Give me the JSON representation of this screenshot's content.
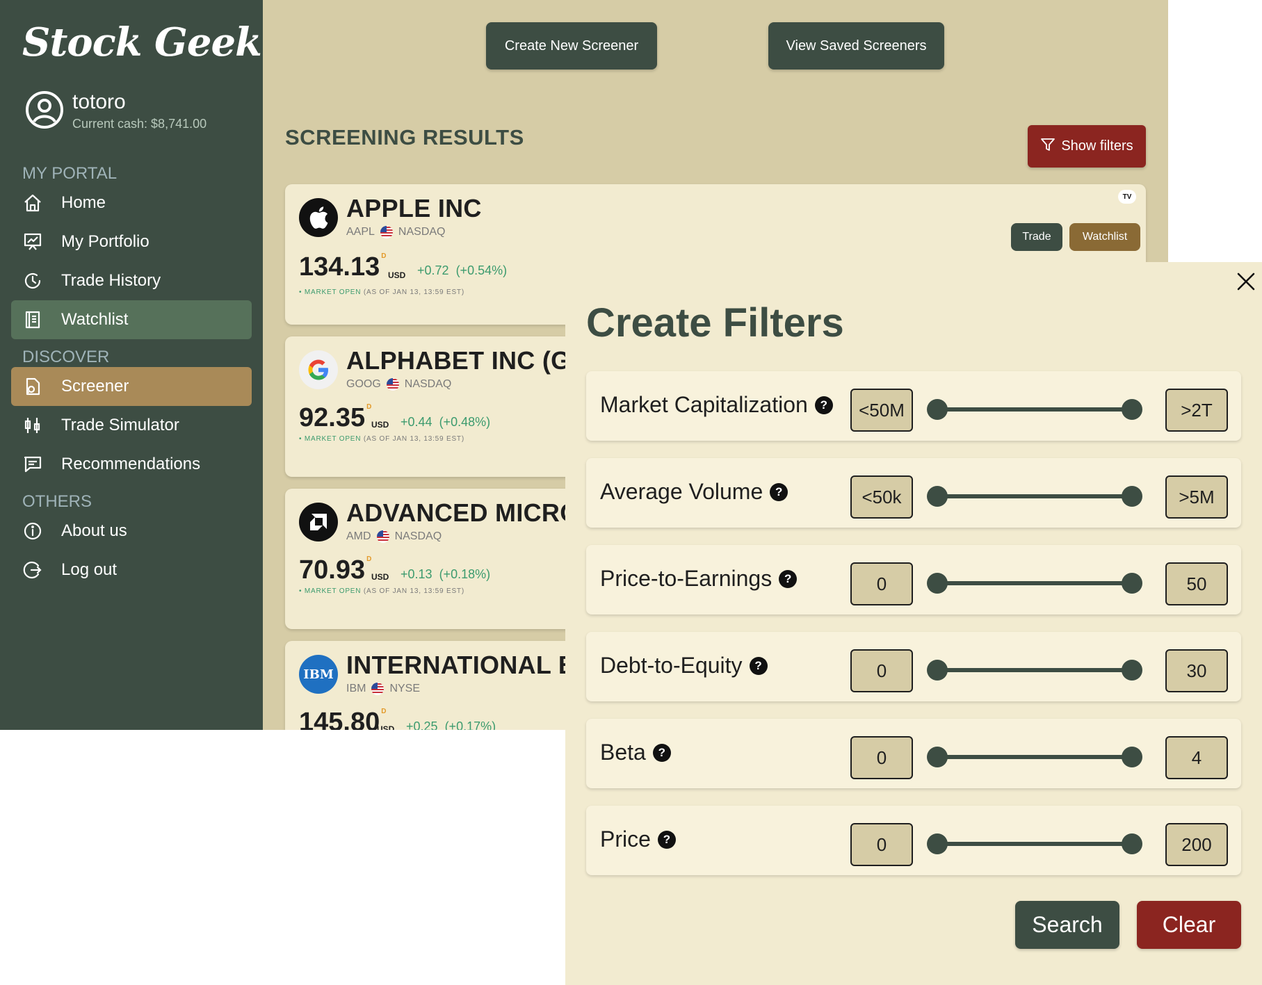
{
  "app": {
    "logo": "Stock Geek"
  },
  "user": {
    "name": "totoro",
    "cash": "Current cash: $8,741.00"
  },
  "sidebar": {
    "sections": [
      {
        "title": "MY PORTAL",
        "items": [
          {
            "label": "Home",
            "icon": "home-icon"
          },
          {
            "label": "My Portfolio",
            "icon": "portfolio-icon"
          },
          {
            "label": "Trade History",
            "icon": "history-icon"
          },
          {
            "label": "Watchlist",
            "icon": "watchlist-icon"
          }
        ]
      },
      {
        "title": "DISCOVER",
        "items": [
          {
            "label": "Screener",
            "icon": "screener-icon"
          },
          {
            "label": "Trade Simulator",
            "icon": "simulator-icon"
          },
          {
            "label": "Recommendations",
            "icon": "recommendations-icon"
          }
        ]
      },
      {
        "title": "OTHERS",
        "items": [
          {
            "label": "About us",
            "icon": "info-icon"
          },
          {
            "label": "Log out",
            "icon": "logout-icon"
          }
        ]
      }
    ]
  },
  "toolbar": {
    "create_label": "Create New Screener",
    "view_label": "View Saved Screeners"
  },
  "results": {
    "title": "SCREENING RESULTS",
    "show_filters_label": "Show filters"
  },
  "stocks": [
    {
      "name": "APPLE INC",
      "ticker": "AAPL",
      "exchange": "NASDAQ",
      "price": "134.13",
      "price_marker": "D",
      "currency": "USD",
      "change": "+0.72",
      "change_pct": "(+0.54%)",
      "status": "MARKET OPEN",
      "as_of": "(AS OF JAN 13, 13:59 EST)",
      "trade_label": "Trade",
      "watchlist_label": "Watchlist",
      "badge": "TV"
    },
    {
      "name": "ALPHABET INC (GOOGLE)",
      "ticker": "GOOG",
      "exchange": "NASDAQ",
      "price": "92.35",
      "price_marker": "D",
      "currency": "USD",
      "change": "+0.44",
      "change_pct": "(+0.48%)",
      "status": "MARKET OPEN",
      "as_of": "(AS OF JAN 13, 13:59 EST)"
    },
    {
      "name": "ADVANCED MICRO DEVICES",
      "ticker": "AMD",
      "exchange": "NASDAQ",
      "price": "70.93",
      "price_marker": "D",
      "currency": "USD",
      "change": "+0.13",
      "change_pct": "(+0.18%)",
      "status": "MARKET OPEN",
      "as_of": "(AS OF JAN 13, 13:59 EST)"
    },
    {
      "name": "INTERNATIONAL BUSINESS MACHINES",
      "ticker": "IBM",
      "exchange": "NYSE",
      "price": "145.80",
      "price_marker": "D",
      "currency": "USD",
      "change": "+0.25",
      "change_pct": "(+0.17%)",
      "logo_text": "IBM"
    }
  ],
  "filter_panel": {
    "title": "Create Filters",
    "help_glyph": "?",
    "filters": [
      {
        "label": "Market Capitalization",
        "min": "<50M",
        "max": ">2T"
      },
      {
        "label": "Average Volume",
        "min": "<50k",
        "max": ">5M"
      },
      {
        "label": "Price-to-Earnings",
        "min": "0",
        "max": "50"
      },
      {
        "label": "Debt-to-Equity",
        "min": "0",
        "max": "30"
      },
      {
        "label": "Beta",
        "min": "0",
        "max": "4"
      },
      {
        "label": "Price",
        "min": "0",
        "max": "200"
      }
    ],
    "search_label": "Search",
    "clear_label": "Clear"
  },
  "colors": {
    "sidebar_bg": "#3d4d43",
    "main_bg": "#d6cca6",
    "card_bg": "#f2ebd0",
    "accent_gold": "#a98a58",
    "accent_red": "#8b2520",
    "positive": "#3c9b6e"
  }
}
